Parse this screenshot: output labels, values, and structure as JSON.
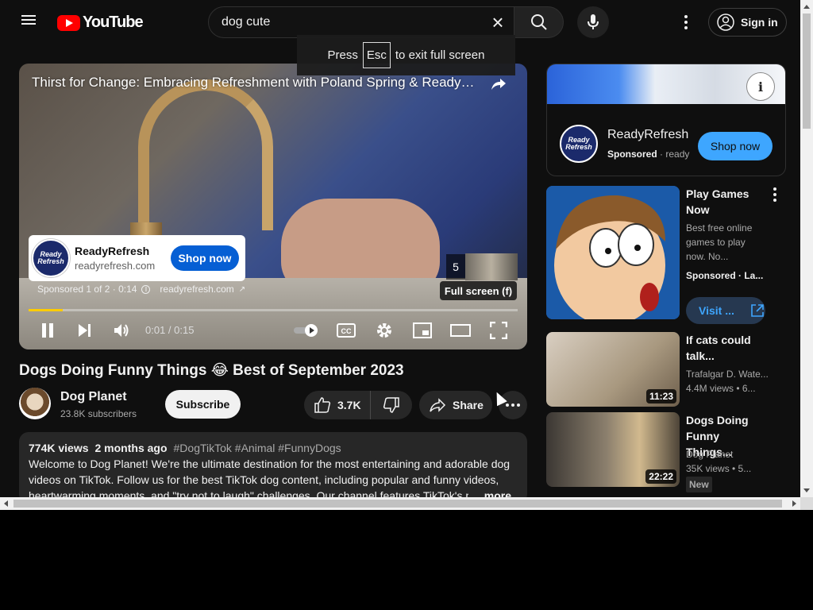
{
  "header": {
    "logo_text": "YouTube",
    "search_value": "dog cute",
    "sign_in": "Sign in"
  },
  "toast": {
    "press": "Press",
    "key": "Esc",
    "rest": "to exit full screen"
  },
  "player": {
    "title": "Thirst for Change: Embracing Refreshment with Poland Spring & ReadyRefresh",
    "ad": {
      "logo_text": "Ready Refresh",
      "name": "ReadyRefresh",
      "url": "readyrefresh.com",
      "cta": "Shop now"
    },
    "sponsored": "Sponsored 1 of 2 · 0:14",
    "sponsored_url": "readyrefresh.com",
    "next_ad_number": "5",
    "fullscreen_tip": "Full screen (f)",
    "time": "0:01 / 0:15",
    "progress_fraction": 0.07
  },
  "video": {
    "title": "Dogs Doing Funny Things 😂 Best of September 2023",
    "channel_name": "Dog Planet",
    "subscribers": "23.8K subscribers",
    "subscribe": "Subscribe",
    "likes": "3.7K",
    "share": "Share",
    "views": "774K views",
    "age": "2 months ago",
    "tags": "#DogTikTok #Animal #FunnyDogs",
    "description": "Welcome to Dog Planet! We're the ultimate destination for the most entertaining and adorable dog videos on TikTok. Follow us for the best TikTok dog content, including popular and funny videos, heartwarming moments, and \"try not to laugh\" challenges. Our channel features TikTok's m",
    "more": "...more"
  },
  "sidebar_ad": {
    "logo_text": "Ready Refresh",
    "name": "ReadyRefresh",
    "sponsored": "Sponsored",
    "domain": "ready",
    "cta": "Shop now"
  },
  "recommendations": [
    {
      "title": "Play Games Now",
      "description": "Best free online games to play now. No...",
      "meta": "Sponsored · La...",
      "cta": "Visit ..."
    },
    {
      "title": "If cats could talk...",
      "channel": "Trafalgar D. Wate...",
      "stats": "4.4M views • 6...",
      "duration": "11:23"
    },
    {
      "title": "Dogs Doing Funny Things...",
      "channel": "Dog Planet",
      "stats": "35K views • 5...",
      "badge": "New",
      "duration": "22:22"
    }
  ]
}
